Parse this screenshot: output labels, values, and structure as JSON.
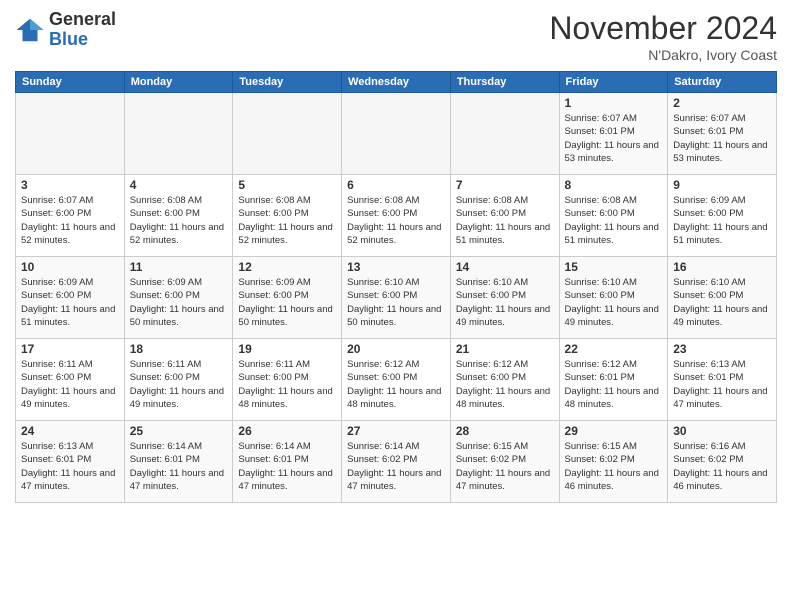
{
  "logo": {
    "general": "General",
    "blue": "Blue"
  },
  "header": {
    "title": "November 2024",
    "location": "N'Dakro, Ivory Coast"
  },
  "weekdays": [
    "Sunday",
    "Monday",
    "Tuesday",
    "Wednesday",
    "Thursday",
    "Friday",
    "Saturday"
  ],
  "weeks": [
    [
      {
        "day": "",
        "info": ""
      },
      {
        "day": "",
        "info": ""
      },
      {
        "day": "",
        "info": ""
      },
      {
        "day": "",
        "info": ""
      },
      {
        "day": "",
        "info": ""
      },
      {
        "day": "1",
        "info": "Sunrise: 6:07 AM\nSunset: 6:01 PM\nDaylight: 11 hours and 53 minutes."
      },
      {
        "day": "2",
        "info": "Sunrise: 6:07 AM\nSunset: 6:01 PM\nDaylight: 11 hours and 53 minutes."
      }
    ],
    [
      {
        "day": "3",
        "info": "Sunrise: 6:07 AM\nSunset: 6:00 PM\nDaylight: 11 hours and 52 minutes."
      },
      {
        "day": "4",
        "info": "Sunrise: 6:08 AM\nSunset: 6:00 PM\nDaylight: 11 hours and 52 minutes."
      },
      {
        "day": "5",
        "info": "Sunrise: 6:08 AM\nSunset: 6:00 PM\nDaylight: 11 hours and 52 minutes."
      },
      {
        "day": "6",
        "info": "Sunrise: 6:08 AM\nSunset: 6:00 PM\nDaylight: 11 hours and 52 minutes."
      },
      {
        "day": "7",
        "info": "Sunrise: 6:08 AM\nSunset: 6:00 PM\nDaylight: 11 hours and 51 minutes."
      },
      {
        "day": "8",
        "info": "Sunrise: 6:08 AM\nSunset: 6:00 PM\nDaylight: 11 hours and 51 minutes."
      },
      {
        "day": "9",
        "info": "Sunrise: 6:09 AM\nSunset: 6:00 PM\nDaylight: 11 hours and 51 minutes."
      }
    ],
    [
      {
        "day": "10",
        "info": "Sunrise: 6:09 AM\nSunset: 6:00 PM\nDaylight: 11 hours and 51 minutes."
      },
      {
        "day": "11",
        "info": "Sunrise: 6:09 AM\nSunset: 6:00 PM\nDaylight: 11 hours and 50 minutes."
      },
      {
        "day": "12",
        "info": "Sunrise: 6:09 AM\nSunset: 6:00 PM\nDaylight: 11 hours and 50 minutes."
      },
      {
        "day": "13",
        "info": "Sunrise: 6:10 AM\nSunset: 6:00 PM\nDaylight: 11 hours and 50 minutes."
      },
      {
        "day": "14",
        "info": "Sunrise: 6:10 AM\nSunset: 6:00 PM\nDaylight: 11 hours and 49 minutes."
      },
      {
        "day": "15",
        "info": "Sunrise: 6:10 AM\nSunset: 6:00 PM\nDaylight: 11 hours and 49 minutes."
      },
      {
        "day": "16",
        "info": "Sunrise: 6:10 AM\nSunset: 6:00 PM\nDaylight: 11 hours and 49 minutes."
      }
    ],
    [
      {
        "day": "17",
        "info": "Sunrise: 6:11 AM\nSunset: 6:00 PM\nDaylight: 11 hours and 49 minutes."
      },
      {
        "day": "18",
        "info": "Sunrise: 6:11 AM\nSunset: 6:00 PM\nDaylight: 11 hours and 49 minutes."
      },
      {
        "day": "19",
        "info": "Sunrise: 6:11 AM\nSunset: 6:00 PM\nDaylight: 11 hours and 48 minutes."
      },
      {
        "day": "20",
        "info": "Sunrise: 6:12 AM\nSunset: 6:00 PM\nDaylight: 11 hours and 48 minutes."
      },
      {
        "day": "21",
        "info": "Sunrise: 6:12 AM\nSunset: 6:00 PM\nDaylight: 11 hours and 48 minutes."
      },
      {
        "day": "22",
        "info": "Sunrise: 6:12 AM\nSunset: 6:01 PM\nDaylight: 11 hours and 48 minutes."
      },
      {
        "day": "23",
        "info": "Sunrise: 6:13 AM\nSunset: 6:01 PM\nDaylight: 11 hours and 47 minutes."
      }
    ],
    [
      {
        "day": "24",
        "info": "Sunrise: 6:13 AM\nSunset: 6:01 PM\nDaylight: 11 hours and 47 minutes."
      },
      {
        "day": "25",
        "info": "Sunrise: 6:14 AM\nSunset: 6:01 PM\nDaylight: 11 hours and 47 minutes."
      },
      {
        "day": "26",
        "info": "Sunrise: 6:14 AM\nSunset: 6:01 PM\nDaylight: 11 hours and 47 minutes."
      },
      {
        "day": "27",
        "info": "Sunrise: 6:14 AM\nSunset: 6:02 PM\nDaylight: 11 hours and 47 minutes."
      },
      {
        "day": "28",
        "info": "Sunrise: 6:15 AM\nSunset: 6:02 PM\nDaylight: 11 hours and 47 minutes."
      },
      {
        "day": "29",
        "info": "Sunrise: 6:15 AM\nSunset: 6:02 PM\nDaylight: 11 hours and 46 minutes."
      },
      {
        "day": "30",
        "info": "Sunrise: 6:16 AM\nSunset: 6:02 PM\nDaylight: 11 hours and 46 minutes."
      }
    ]
  ]
}
